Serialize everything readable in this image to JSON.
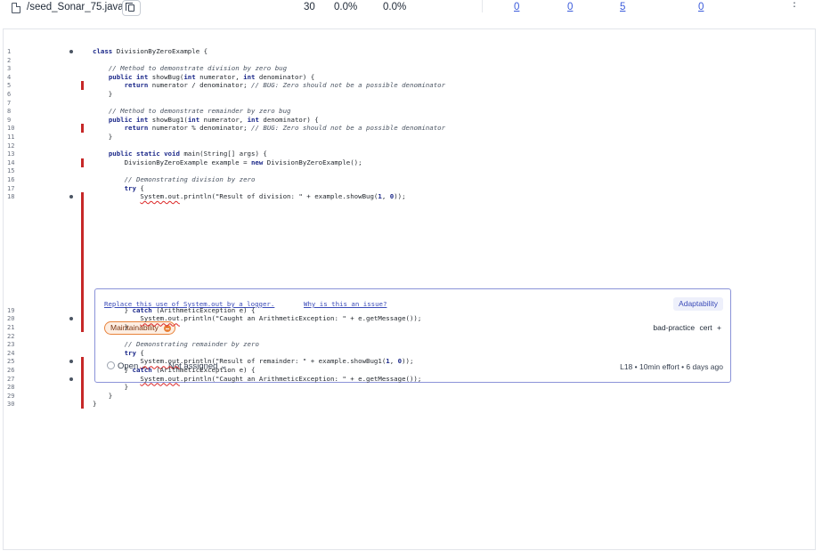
{
  "header": {
    "file_name": "/seed_Sonar_75.java",
    "lines": "30",
    "coverage_1": "0.0%",
    "coverage_2": "0.0%",
    "metric_1": "0",
    "metric_2": "0",
    "metric_3": "5",
    "metric_4": "0",
    "menu_glyph": "⋮"
  },
  "code": {
    "lines": [
      {
        "n": "1",
        "dot": true,
        "bar": false,
        "html": "<span class=\"kw\">class</span> DivisionByZeroExample {"
      },
      {
        "n": "2",
        "dot": false,
        "bar": false,
        "html": ""
      },
      {
        "n": "3",
        "dot": false,
        "bar": false,
        "html": "    <span class=\"cm\">// Method to demonstrate division by zero bug</span>"
      },
      {
        "n": "4",
        "dot": false,
        "bar": false,
        "html": "    <span class=\"kw\">public int</span> showBug(<span class=\"kw\">int</span> numerator, <span class=\"kw\">int</span> denominator) {"
      },
      {
        "n": "5",
        "dot": false,
        "bar": true,
        "html": "        <span class=\"kw\">return</span> numerator / denominator; <span class=\"cm\">// BUG: Zero should not be a possible denominator</span>"
      },
      {
        "n": "6",
        "dot": false,
        "bar": false,
        "html": "    }"
      },
      {
        "n": "7",
        "dot": false,
        "bar": false,
        "html": ""
      },
      {
        "n": "8",
        "dot": false,
        "bar": false,
        "html": "    <span class=\"cm\">// Method to demonstrate remainder by zero bug</span>"
      },
      {
        "n": "9",
        "dot": false,
        "bar": false,
        "html": "    <span class=\"kw\">public int</span> showBug1(<span class=\"kw\">int</span> numerator, <span class=\"kw\">int</span> denominator) {"
      },
      {
        "n": "10",
        "dot": false,
        "bar": true,
        "html": "        <span class=\"kw\">return</span> numerator % denominator; <span class=\"cm\">// BUG: Zero should not be a possible denominator</span>"
      },
      {
        "n": "11",
        "dot": false,
        "bar": false,
        "html": "    }"
      },
      {
        "n": "12",
        "dot": false,
        "bar": false,
        "html": ""
      },
      {
        "n": "13",
        "dot": false,
        "bar": false,
        "html": "    <span class=\"kw\">public static void</span> main(String[] args) {"
      },
      {
        "n": "14",
        "dot": false,
        "bar": true,
        "html": "        DivisionByZeroExample example = <span class=\"kw\">new</span> DivisionByZeroExample();"
      },
      {
        "n": "15",
        "dot": false,
        "bar": false,
        "html": ""
      },
      {
        "n": "16",
        "dot": false,
        "bar": false,
        "html": "        <span class=\"cm\">// Demonstrating division by zero</span>"
      },
      {
        "n": "17",
        "dot": false,
        "bar": false,
        "html": "        <span class=\"kw\">try</span> {"
      },
      {
        "n": "18",
        "dot": true,
        "bar": true,
        "html": "            <span class=\"sqg\">System.out</span>.println(\"Result of division: \" + example.showBug(<span class=\"kw\">1</span>, <span class=\"kw\">0</span>));"
      },
      {
        "n": "19",
        "dot": false,
        "bar": true,
        "html": "        } <span class=\"kw\">catch</span> (ArithmeticException e) {"
      },
      {
        "n": "20",
        "dot": true,
        "bar": true,
        "html": "            <span class=\"sqg\">System.out</span>.println(\"Caught an ArithmeticException: \" + e.getMessage());"
      },
      {
        "n": "21",
        "dot": false,
        "bar": true,
        "html": "        }"
      },
      {
        "n": "22",
        "dot": false,
        "bar": false,
        "html": ""
      },
      {
        "n": "23",
        "dot": false,
        "bar": false,
        "html": "        <span class=\"cm\">// Demonstrating remainder by zero</span>"
      },
      {
        "n": "24",
        "dot": false,
        "bar": false,
        "html": "        <span class=\"kw\">try</span> {"
      },
      {
        "n": "25",
        "dot": true,
        "bar": true,
        "html": "            <span class=\"sqg\">System.out</span>.println(\"Result of remainder: \" + example.showBug1(<span class=\"kw\">1</span>, <span class=\"kw\">0</span>));"
      },
      {
        "n": "26",
        "dot": false,
        "bar": true,
        "html": "        } <span class=\"kw\">catch</span> (ArithmeticException e) {"
      },
      {
        "n": "27",
        "dot": true,
        "bar": true,
        "html": "            <span class=\"sqg\">System.out</span>.println(\"Caught an ArithmeticException: \" + e.getMessage());"
      },
      {
        "n": "28",
        "dot": false,
        "bar": true,
        "html": "        }"
      },
      {
        "n": "29",
        "dot": false,
        "bar": true,
        "html": "    }"
      },
      {
        "n": "30",
        "dot": false,
        "bar": true,
        "html": "}"
      }
    ]
  },
  "issue": {
    "message": "Replace this use of System.out by a logger.",
    "why_link": "Why is this an issue?",
    "attribute": "Adaptability",
    "quality": "Maintainability",
    "tags": "bad-practice  cert  +",
    "status": "Open",
    "assignee": "Not assigned",
    "effort": "L18 • 10min effort • 6 days ago"
  },
  "colors": {
    "coverage_bar": "#c62828",
    "link": "#3b5bdb",
    "issue_border": "#8b93d8",
    "maintainability": "#e8823b"
  },
  "icons": [
    "file-icon",
    "copy-icon",
    "kebab-menu-icon",
    "chevron-down-icon",
    "radio-icon",
    "severity-icon"
  ]
}
